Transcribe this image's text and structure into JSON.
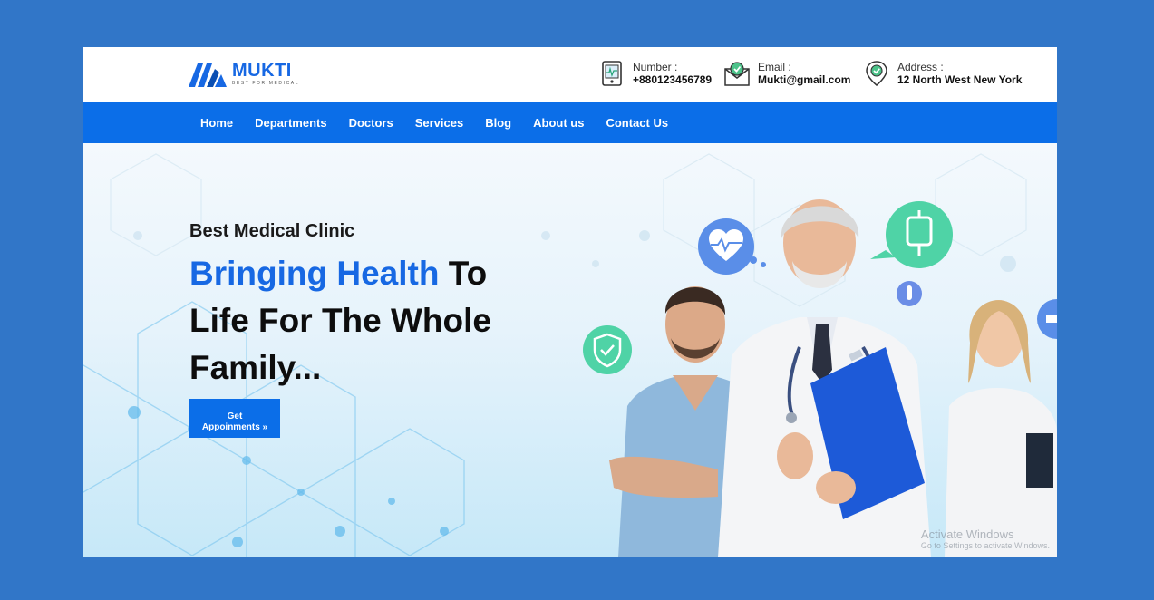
{
  "brand": {
    "name": "MUKTI",
    "tagline": "BEST FOR MEDICAL",
    "accent_color": "#1768e3"
  },
  "contacts": [
    {
      "icon": "phone-icon",
      "label": "Number :",
      "value": "+880123456789"
    },
    {
      "icon": "mail-icon",
      "label": "Email :",
      "value": "Mukti@gmail.com"
    },
    {
      "icon": "location-pin-icon",
      "label": "Address :",
      "value": "12 North West New York"
    }
  ],
  "nav": {
    "items": [
      "Home",
      "Departments",
      "Doctors",
      "Services",
      "Blog",
      "About us",
      "Contact Us"
    ],
    "background": "#0b6ee8"
  },
  "hero": {
    "kicker": "Best Medical Clinic",
    "headline_accent": "Bringing Health",
    "headline_rest_1": " To",
    "headline_line2": "Life For The Whole",
    "headline_line3": "Family...",
    "cta_line1": "Get",
    "cta_line2": "Appoinments »"
  },
  "watermark": {
    "line1": "Activate Windows",
    "line2": "Go to Settings to activate Windows."
  }
}
